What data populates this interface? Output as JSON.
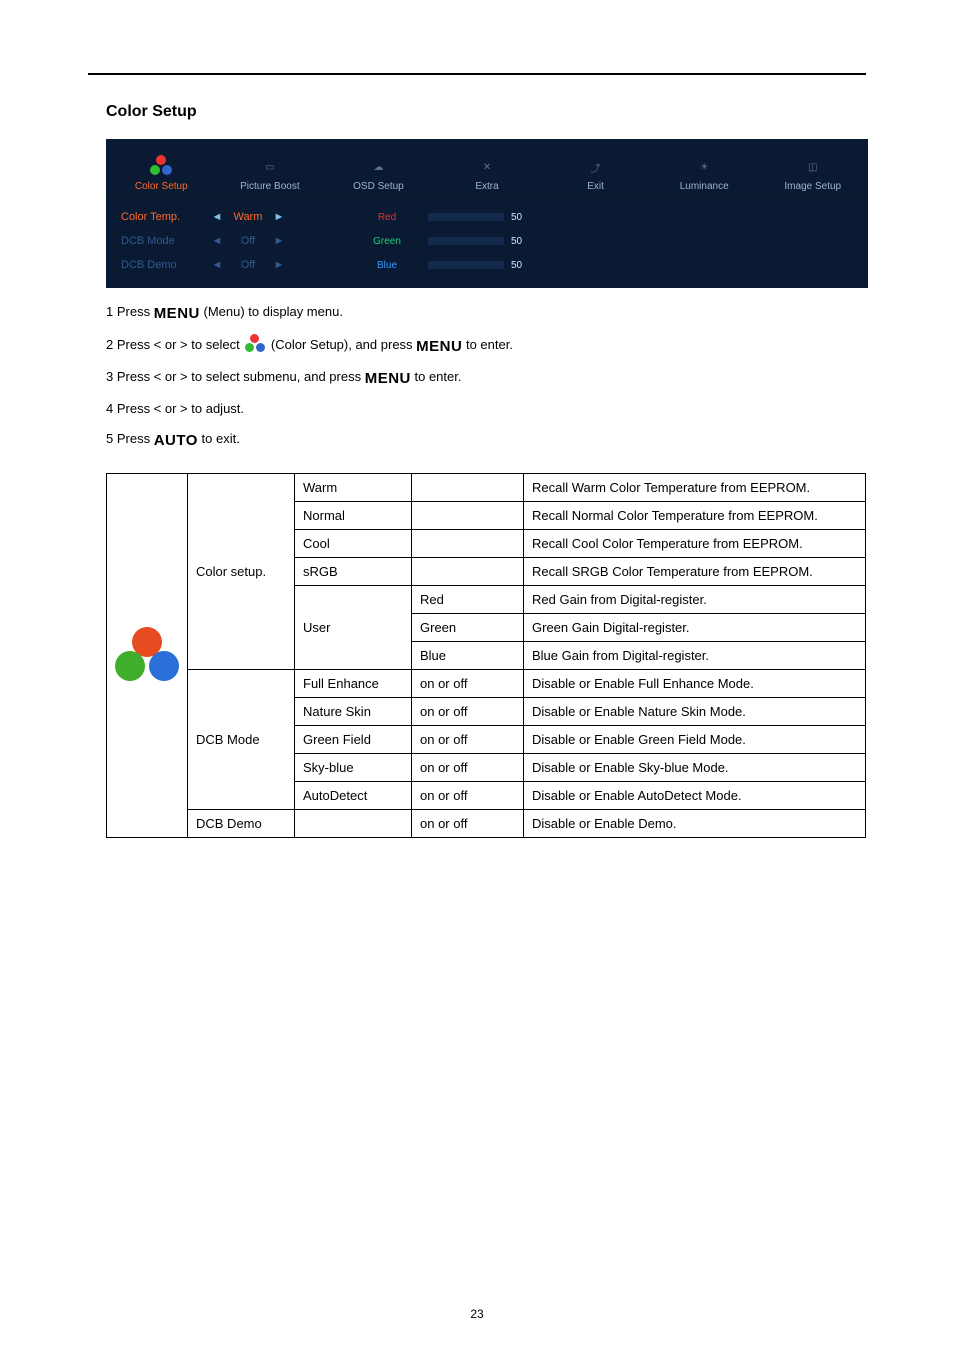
{
  "page_number": "23",
  "section_title": "Color Setup",
  "osd": {
    "tabs": [
      {
        "label": "Color Setup",
        "active": true
      },
      {
        "label": "Picture Boost"
      },
      {
        "label": "OSD Setup"
      },
      {
        "label": "Extra"
      },
      {
        "label": "Exit"
      },
      {
        "label": "Luminance"
      },
      {
        "label": "Image Setup"
      }
    ],
    "rows": [
      {
        "name": "Color Temp.",
        "value": "Warm",
        "channel": "Red",
        "num": "50",
        "active": true,
        "slider": "red"
      },
      {
        "name": "DCB Mode",
        "value": "Off",
        "channel": "Green",
        "num": "50",
        "active": false,
        "slider": "green"
      },
      {
        "name": "DCB Demo",
        "value": "Off",
        "channel": "Blue",
        "num": "50",
        "active": false,
        "slider": "blue"
      }
    ]
  },
  "steps": {
    "s1_pre": "1 Press ",
    "s1_menu": "MENU",
    "s1_post": " (Menu) to display menu.",
    "s2_pre": "2 Press < or > to select ",
    "s2_mid": " (Color Setup), and press ",
    "s2_menu": "MENU",
    "s2_post": " to enter.",
    "s3_pre": "3 Press < or > to select submenu, and press ",
    "s3_menu": "MENU",
    "s3_post": " to enter.",
    "s4": "4 Press < or > to adjust.",
    "s5_pre": "5 Press ",
    "s5_auto": "AUTO",
    "s5_post": " to exit."
  },
  "desc_table": {
    "color_setup_label": "Color setup.",
    "dcb_mode_label": "DCB Mode",
    "dcb_demo_label": "DCB Demo",
    "rows": [
      {
        "a": "Warm",
        "b": "",
        "c": "Recall Warm Color Temperature from EEPROM."
      },
      {
        "a": "Normal",
        "b": "",
        "c": "Recall Normal Color Temperature from EEPROM."
      },
      {
        "a": "Cool",
        "b": "",
        "c": "Recall Cool Color Temperature from EEPROM."
      },
      {
        "a": "sRGB",
        "b": "",
        "c": "Recall SRGB Color Temperature from EEPROM."
      },
      {
        "a": "",
        "b": "Red",
        "c": "Red Gain from Digital-register."
      },
      {
        "a": "User",
        "b": "Green",
        "c": "Green Gain Digital-register."
      },
      {
        "a": "",
        "b": "Blue",
        "c": "Blue Gain from Digital-register."
      },
      {
        "a": "Full Enhance",
        "b": "on or off",
        "c": "Disable or Enable Full Enhance Mode."
      },
      {
        "a": "Nature Skin",
        "b": "on or off",
        "c": "Disable or Enable Nature Skin Mode."
      },
      {
        "a": "Green Field",
        "b": "on or off",
        "c": "Disable or Enable Green Field Mode."
      },
      {
        "a": "Sky-blue",
        "b": "on or off",
        "c": "Disable or Enable Sky-blue Mode."
      },
      {
        "a": "AutoDetect",
        "b": "on or off",
        "c": "Disable or Enable AutoDetect Mode."
      },
      {
        "a": "",
        "b": "on or off",
        "c": "Disable or Enable Demo."
      }
    ]
  }
}
